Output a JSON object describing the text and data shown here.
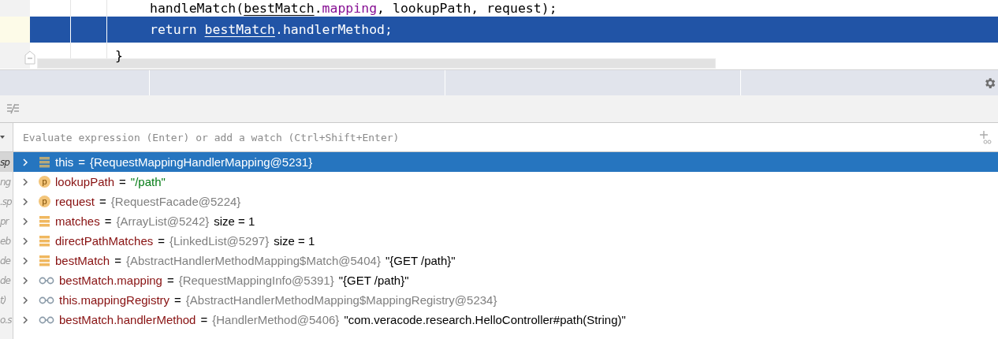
{
  "editor": {
    "lines": [
      {
        "selected": false,
        "kind": "statement",
        "tokens": [
          {
            "kind": "plain",
            "text": "handleMatch("
          },
          {
            "kind": "underlined",
            "text": "bestMatch"
          },
          {
            "kind": "plain",
            "text": "."
          },
          {
            "kind": "field",
            "text": "mapping"
          },
          {
            "kind": "plain",
            "text": ", lookupPath, request);"
          }
        ]
      },
      {
        "selected": true,
        "kind": "statement",
        "tokens": [
          {
            "kind": "plain",
            "text": "return "
          },
          {
            "kind": "underlined",
            "text": "bestMatch"
          },
          {
            "kind": "plain",
            "text": ".handlerMethod;"
          }
        ]
      },
      {
        "selected": false,
        "kind": "block_end",
        "tokens": [
          {
            "kind": "plain",
            "text": "}"
          }
        ]
      }
    ]
  },
  "watch_field": {
    "placeholder": "Evaluate expression (Enter) or add a watch (Ctrl+Shift+Enter)"
  },
  "frames": [
    {
      "text": "sp",
      "selected": true
    },
    {
      "text": "ng",
      "selected": false
    },
    {
      "text": ".sp",
      "selected": false
    },
    {
      "text": "pr",
      "selected": false
    },
    {
      "text": "eb",
      "selected": false
    },
    {
      "text": "de",
      "selected": false
    },
    {
      "text": "de",
      "selected": false
    },
    {
      "text": "t)",
      "selected": false
    },
    {
      "text": "o.s",
      "selected": false
    }
  ],
  "variables": [
    {
      "kind": "field",
      "name": "this",
      "equals": "=",
      "value": {
        "kind": "object",
        "text": "{RequestMappingHandlerMapping@5231}"
      },
      "selected": true
    },
    {
      "kind": "param",
      "badge": "p",
      "name": "lookupPath",
      "equals": "=",
      "value": {
        "kind": "string",
        "text": "\"/path\""
      },
      "selected": false
    },
    {
      "kind": "param",
      "badge": "p",
      "name": "request",
      "equals": "=",
      "value": {
        "kind": "object",
        "text": "{RequestFacade@5224}"
      },
      "selected": false
    },
    {
      "kind": "field",
      "name": "matches",
      "equals": "=",
      "value": {
        "kind": "object",
        "text": "{ArrayList@5242}"
      },
      "extra": "size = 1",
      "selected": false
    },
    {
      "kind": "field",
      "name": "directPathMatches",
      "equals": "=",
      "value": {
        "kind": "object",
        "text": "{LinkedList@5297}"
      },
      "extra": "size = 1",
      "selected": false
    },
    {
      "kind": "field",
      "name": "bestMatch",
      "equals": "=",
      "value": {
        "kind": "object",
        "text": "{AbstractHandlerMethodMapping$Match@5404}"
      },
      "extra": "\"{GET /path}\"",
      "selected": false
    },
    {
      "kind": "watch",
      "name": "bestMatch.mapping",
      "equals": "=",
      "value": {
        "kind": "object",
        "text": "{RequestMappingInfo@5391}"
      },
      "extra": "\"{GET /path}\"",
      "selected": false
    },
    {
      "kind": "watch",
      "name": "this.mappingRegistry",
      "equals": "=",
      "value": {
        "kind": "object",
        "text": "{AbstractHandlerMethodMapping$MappingRegistry@5234}"
      },
      "selected": false
    },
    {
      "kind": "watch",
      "name": "bestMatch.handlerMethod",
      "equals": "=",
      "value": {
        "kind": "object",
        "text": "{HandlerMethod@5406}"
      },
      "extra": "\"com.veracode.research.HelloController#path(String)\"",
      "selected": false
    }
  ]
}
